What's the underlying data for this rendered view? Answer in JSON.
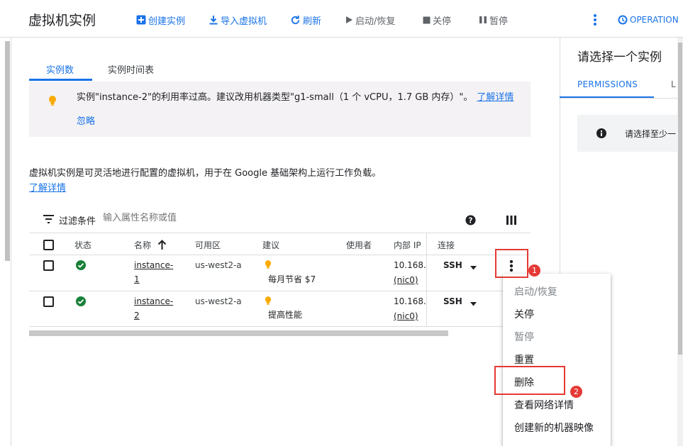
{
  "header": {
    "title": "虚拟机实例",
    "actions": [
      {
        "label": "创建实例",
        "icon": "add-box-icon"
      },
      {
        "label": "导入虚拟机",
        "icon": "download-icon"
      },
      {
        "label": "刷新",
        "icon": "refresh-icon"
      },
      {
        "label": "启动/恢复",
        "icon": "play-icon"
      },
      {
        "label": "关停",
        "icon": "stop-icon"
      },
      {
        "label": "暂停",
        "icon": "pause-icon"
      }
    ],
    "operations_label": "OPERATION",
    "colors": {
      "accent": "#1a73e8",
      "text": "#202124",
      "muted": "#5f6368"
    }
  },
  "tabs": [
    {
      "label": "实例数",
      "active": true
    },
    {
      "label": "实例时间表",
      "active": false
    }
  ],
  "recommendation": {
    "text": "实例\"instance-2\"的利用率过高。建议改用机器类型\"g1-small（1 个 vCPU，1.7 GB 内存）\"。",
    "learn_more": "了解详情",
    "dismiss": "忽略",
    "icon": "lightbulb-icon",
    "icon_color": "#f9ab00"
  },
  "description": {
    "text": "虚拟机实例是可灵活地进行配置的虚拟机，用于在 Google 基础架构上运行工作负载。",
    "link": "了解详情"
  },
  "filter": {
    "label": "过滤条件",
    "placeholder": "输入属性名称或值"
  },
  "table": {
    "columns": [
      "状态",
      "名称",
      "可用区",
      "建议",
      "使用者",
      "内部 IP",
      "连接"
    ],
    "sort_indicator": "arrow-up-icon",
    "rows": [
      {
        "name_line1": "instance-",
        "name_line2": "1",
        "zone": "us-west2-a",
        "recommendation": "每月节省 $7",
        "internal_ip": "10.168.0",
        "nic": "(nic0)",
        "connect": "SSH"
      },
      {
        "name_line1": "instance-",
        "name_line2": "2",
        "zone": "us-west2-a",
        "recommendation": "提高性能",
        "internal_ip": "10.168.0",
        "nic": "(nic0)",
        "connect": "SSH"
      }
    ],
    "status_color": "#188038"
  },
  "right_panel": {
    "title": "请选择一个实例",
    "tabs": [
      "PERMISSIONS",
      "L"
    ],
    "info": "请选择至少一"
  },
  "context_menu": {
    "items": [
      {
        "label": "启动/恢复",
        "disabled": true
      },
      {
        "label": "关停",
        "disabled": false
      },
      {
        "label": "暂停",
        "disabled": true
      },
      {
        "label": "重置",
        "disabled": false
      },
      {
        "label": "删除",
        "disabled": false
      },
      {
        "label": "查看网络详情",
        "disabled": false
      },
      {
        "label": "创建新的机器映像",
        "disabled": false
      }
    ]
  },
  "annotations": {
    "badge1": "1",
    "badge2": "2",
    "color": "#e53935"
  }
}
